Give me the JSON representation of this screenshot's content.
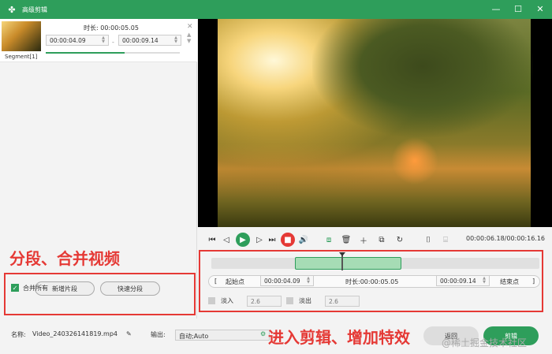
{
  "window": {
    "title": "高级剪辑",
    "min_icon": "minimize-icon",
    "max_icon": "maximize-icon",
    "close_icon": "close-icon",
    "accent": "#2e9e5b"
  },
  "segment": {
    "label": "Segment[1]",
    "duration_label": "时长:",
    "duration": "00:00:05.05",
    "start": "00:00:04.09",
    "end": "00:00:09.14"
  },
  "left_actions": {
    "new_segment": "新增片段",
    "quick_split": "快速分段",
    "merge_all": "合并所有"
  },
  "annotations": {
    "left": "分段、合并视频",
    "right": "进入剪辑、增加特效",
    "color": "#e53935"
  },
  "player": {
    "timecode": "00:00:06.18/00:00:16.16"
  },
  "edit": {
    "start_point": "起始点",
    "start": "00:00:04.09",
    "duration_label": "时长:",
    "duration": "00:00:05.05",
    "end": "00:00:09.14",
    "end_point": "结束点",
    "fade_in": "淡入",
    "fade_in_value": "2.6",
    "fade_out": "淡出",
    "fade_out_value": "2.6"
  },
  "bottom": {
    "name_label": "名称:",
    "filename": "Video_240326141819.mp4",
    "output_label": "输出:",
    "output_value": "自动;Auto",
    "back": "返回",
    "cut": "剪辑",
    "watermark": "@稀土掘金技术社区"
  }
}
